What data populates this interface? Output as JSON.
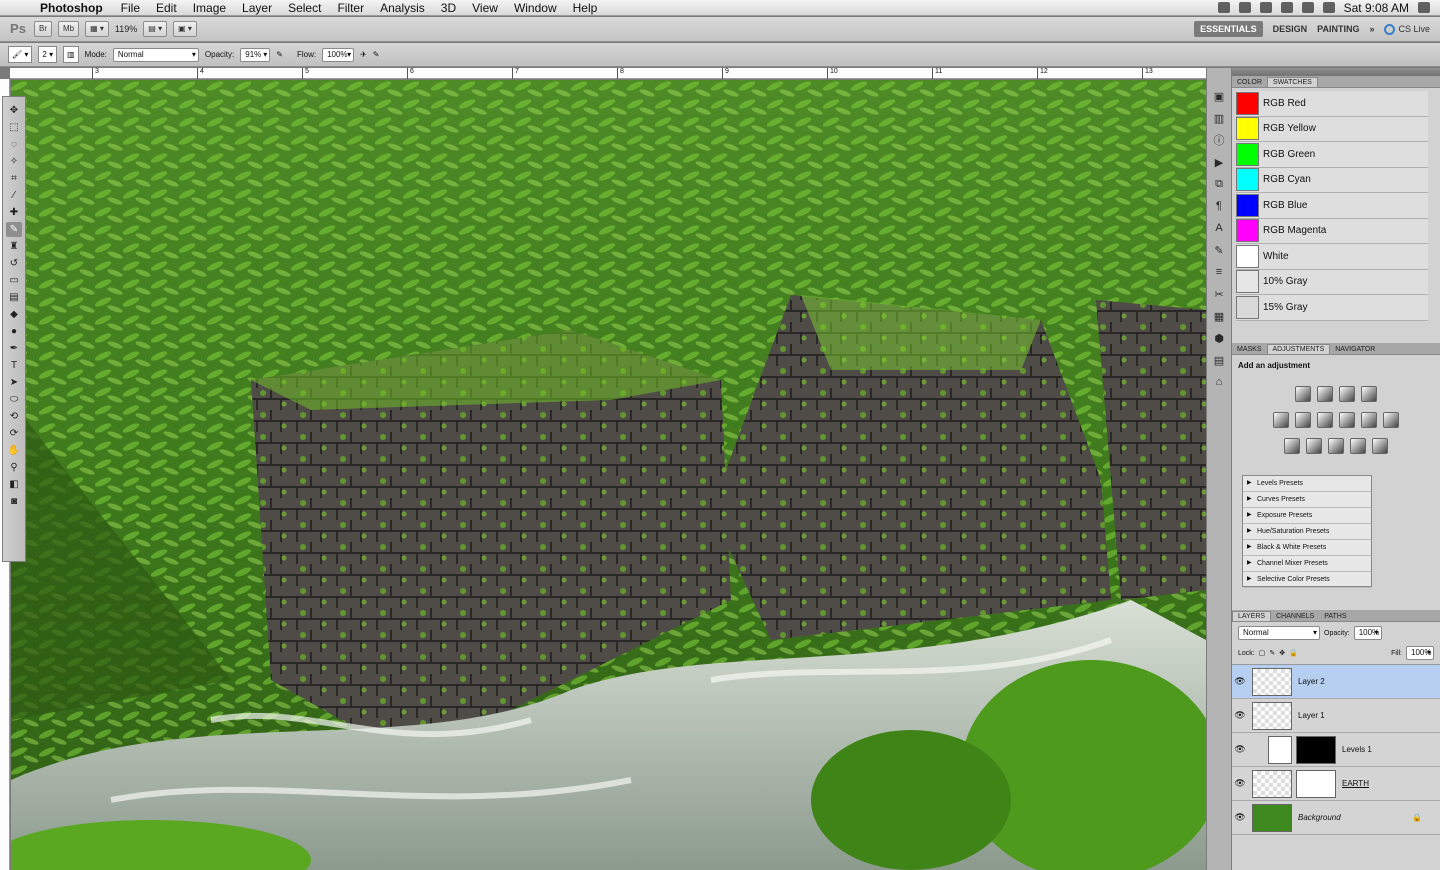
{
  "menubar": {
    "app": "Photoshop",
    "items": [
      "File",
      "Edit",
      "Image",
      "Layer",
      "Select",
      "Filter",
      "Analysis",
      "3D",
      "View",
      "Window",
      "Help"
    ],
    "clock": "Sat 9:08 AM"
  },
  "appbar": {
    "ps": "Ps",
    "br": "Br",
    "mb": "Mb",
    "zoom": "119%",
    "workspaces": [
      "ESSENTIALS",
      "DESIGN",
      "PAINTING"
    ],
    "more": "»",
    "cs_live": "CS Live"
  },
  "options": {
    "brush_size": "2",
    "mode_label": "Mode:",
    "mode": "Normal",
    "opacity_label": "Opacity:",
    "opacity": "91%",
    "flow_label": "Flow:",
    "flow": "100%"
  },
  "ruler": {
    "ticks": [
      "3",
      "4",
      "5",
      "6",
      "7",
      "8",
      "9",
      "10",
      "11",
      "12",
      "13"
    ]
  },
  "swatches": {
    "tabs": [
      "COLOR",
      "SWATCHES"
    ],
    "items": [
      {
        "name": "RGB Red",
        "color": "#ff0000"
      },
      {
        "name": "RGB Yellow",
        "color": "#ffff00"
      },
      {
        "name": "RGB Green",
        "color": "#00ff00"
      },
      {
        "name": "RGB Cyan",
        "color": "#00ffff"
      },
      {
        "name": "RGB Blue",
        "color": "#0000ff"
      },
      {
        "name": "RGB Magenta",
        "color": "#ff00ff"
      },
      {
        "name": "White",
        "color": "#ffffff"
      },
      {
        "name": "10% Gray",
        "color": "#e6e6e6"
      },
      {
        "name": "15% Gray",
        "color": "#d9d9d9"
      }
    ]
  },
  "adjustments": {
    "tabs": [
      "MASKS",
      "ADJUSTMENTS",
      "NAVIGATOR"
    ],
    "label": "Add an adjustment",
    "presets": [
      "Levels Presets",
      "Curves Presets",
      "Exposure Presets",
      "Hue/Saturation Presets",
      "Black & White Presets",
      "Channel Mixer Presets",
      "Selective Color Presets"
    ]
  },
  "layers": {
    "tabs": [
      "LAYERS",
      "CHANNELS",
      "PATHS"
    ],
    "blend": "Normal",
    "opacity_label": "Opacity:",
    "opacity": "100%",
    "lock_label": "Lock:",
    "fill_label": "Fill:",
    "fill": "100%",
    "items": [
      "Layer 2",
      "Layer 1",
      "Levels 1",
      "EARTH",
      "Background"
    ]
  }
}
